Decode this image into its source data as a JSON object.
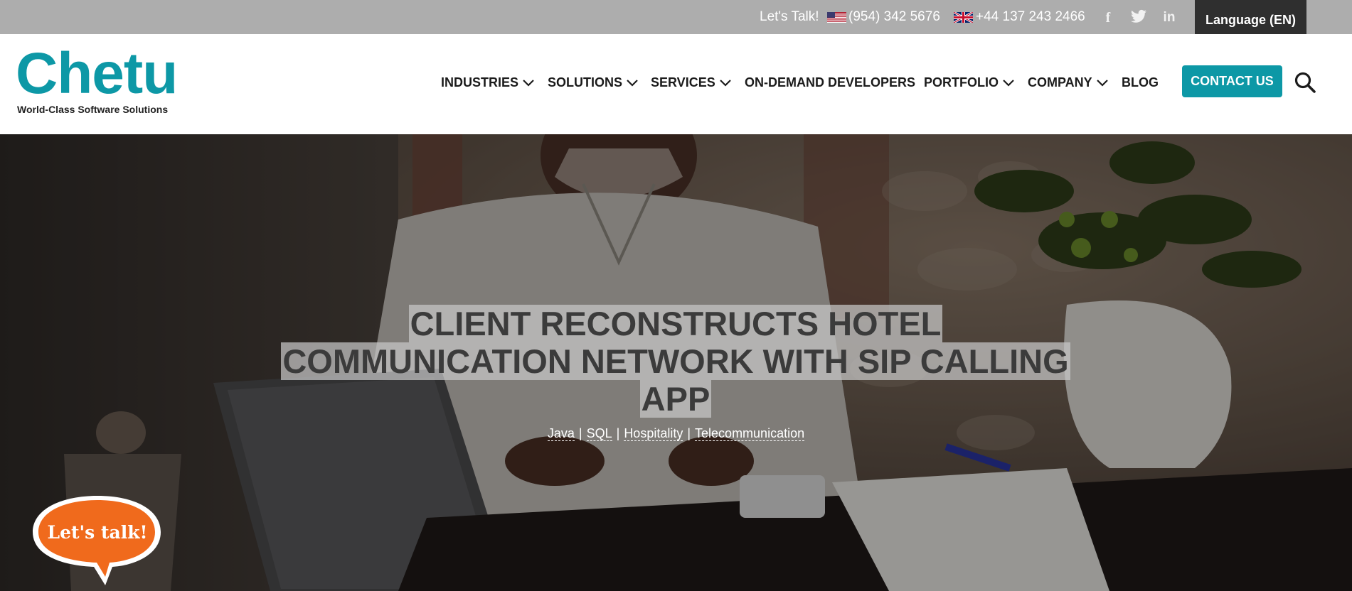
{
  "topbar": {
    "lets_talk": "Let's Talk!",
    "us_phone": "(954) 342 5676",
    "uk_phone": "+44 137 243 2466",
    "social": [
      {
        "name": "facebook-icon",
        "glyph": "f"
      },
      {
        "name": "twitter-icon",
        "glyph": "twitter"
      },
      {
        "name": "linkedin-icon",
        "glyph": "in"
      }
    ],
    "language_label": "Language (EN)"
  },
  "logo": {
    "name": "Chetu",
    "tagline": "World-Class Software Solutions"
  },
  "nav": {
    "items": [
      {
        "label": "INDUSTRIES",
        "dropdown": true
      },
      {
        "label": "SOLUTIONS",
        "dropdown": true
      },
      {
        "label": "SERVICES",
        "dropdown": true
      },
      {
        "label": "ON-DEMAND DEVELOPERS",
        "dropdown": false
      },
      {
        "label": "PORTFOLIO",
        "dropdown": true
      },
      {
        "label": "COMPANY",
        "dropdown": true
      },
      {
        "label": "BLOG",
        "dropdown": false
      }
    ],
    "contact_label": "CONTACT US",
    "search_icon": "search-icon"
  },
  "hero": {
    "title_lines": [
      "CLIENT RECONSTRUCTS HOTEL",
      "COMMUNICATION NETWORK WITH SIP CALLING",
      "APP"
    ],
    "tags": [
      "Java",
      "SQL",
      "Hospitality",
      "Telecommunication"
    ],
    "tag_separator": "|"
  },
  "chat": {
    "label": "Let's talk!"
  },
  "colors": {
    "brand": "#0d98a6",
    "topbar": "#adadad",
    "language_button": "#2f2f2f",
    "chat_orange": "#f06a1c"
  }
}
